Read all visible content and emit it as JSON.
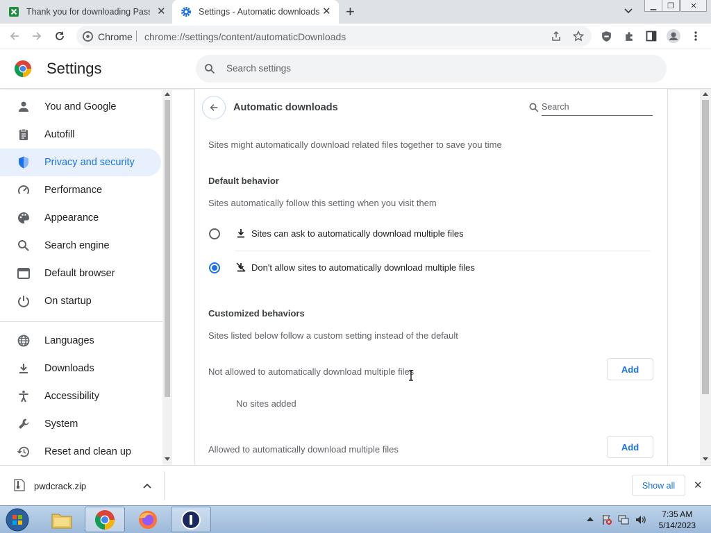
{
  "tabs": [
    {
      "title": "Thank you for downloading Pass",
      "close": "✕"
    },
    {
      "title": "Settings - Automatic downloads",
      "close": "✕"
    }
  ],
  "new_tab": "+",
  "omnibox": {
    "site_label": "Chrome",
    "url": "chrome://settings/content/automaticDownloads"
  },
  "settings": {
    "title": "Settings",
    "search_placeholder": "Search settings"
  },
  "sidebar": {
    "items": [
      {
        "label": "You and Google",
        "icon": "person-icon"
      },
      {
        "label": "Autofill",
        "icon": "clipboard-icon"
      },
      {
        "label": "Privacy and security",
        "icon": "shield-icon"
      },
      {
        "label": "Performance",
        "icon": "speedometer-icon"
      },
      {
        "label": "Appearance",
        "icon": "palette-icon"
      },
      {
        "label": "Search engine",
        "icon": "search-icon"
      },
      {
        "label": "Default browser",
        "icon": "browser-icon"
      },
      {
        "label": "On startup",
        "icon": "power-icon"
      },
      {
        "label": "Languages",
        "icon": "globe-icon"
      },
      {
        "label": "Downloads",
        "icon": "download-icon"
      },
      {
        "label": "Accessibility",
        "icon": "accessibility-icon"
      },
      {
        "label": "System",
        "icon": "wrench-icon"
      },
      {
        "label": "Reset and clean up",
        "icon": "history-icon"
      }
    ],
    "active_index": 2
  },
  "page": {
    "title": "Automatic downloads",
    "search_label": "Search",
    "description": "Sites might automatically download related files together to save you time",
    "default_behavior": {
      "heading": "Default behavior",
      "subtext": "Sites automatically follow this setting when you visit them",
      "options": [
        {
          "label": "Sites can ask to automatically download multiple files",
          "selected": false
        },
        {
          "label": "Don't allow sites to automatically download multiple files",
          "selected": true
        }
      ]
    },
    "customized": {
      "heading": "Customized behaviors",
      "subtext": "Sites listed below follow a custom setting instead of the default",
      "not_allowed_label": "Not allowed to automatically download multiple files",
      "empty_text": "No sites added",
      "allowed_label": "Allowed to automatically download multiple files",
      "add_label": "Add"
    }
  },
  "download_bar": {
    "file_name": "pwdcrack.zip",
    "show_all": "Show all",
    "close": "✕"
  },
  "taskbar": {
    "time": "7:35 AM",
    "date": "5/14/2023"
  },
  "colors": {
    "accent": "#1a73e8",
    "active_bg": "#e8f0fe"
  }
}
